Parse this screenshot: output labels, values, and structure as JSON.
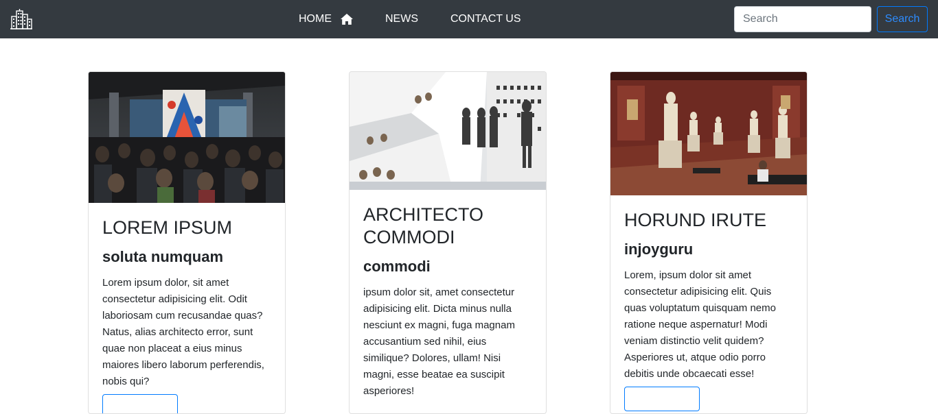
{
  "navbar": {
    "brand_icon": "city-buildings-icon",
    "links": [
      {
        "label": "HOME",
        "icon": "home-icon"
      },
      {
        "label": "NEWS"
      },
      {
        "label": "CONTACT US"
      }
    ],
    "search": {
      "placeholder": "Search",
      "button_label": "Search"
    }
  },
  "cards": [
    {
      "image": "museum-hall-crowd-photo",
      "title": "LOREM IPSUM",
      "subtitle": "soluta numquam",
      "text": "Lorem ipsum dolor, sit amet consectetur adipisicing elit. Odit laboriosam cum recusandae quas? Natus, alias architecto error, sunt quae non placeat a eius minus maiores libero laborum perferendis, nobis qui?"
    },
    {
      "image": "spiral-gallery-photo",
      "title": "ARCHITECTO COMMODI",
      "subtitle": "commodi",
      "text": "ipsum dolor sit, amet consectetur adipisicing elit. Dicta minus nulla nesciunt ex magni, fuga magnam accusantium sed nihil, eius similique? Dolores, ullam! Nisi magni, esse beatae ea suscipit asperiores!"
    },
    {
      "image": "sculpture-gallery-photo",
      "title": "HORUND IRUTE",
      "subtitle": "injoyguru",
      "text": "Lorem, ipsum dolor sit amet consectetur adipisicing elit. Quis quas voluptatum quisquam nemo ratione neque aspernatur! Modi veniam distinctio velit quidem? Asperiores ut, atque odio porro debitis unde obcaecati esse!"
    }
  ],
  "colors": {
    "navbar_bg": "#343a40",
    "primary": "#007bff",
    "text": "#212529"
  }
}
